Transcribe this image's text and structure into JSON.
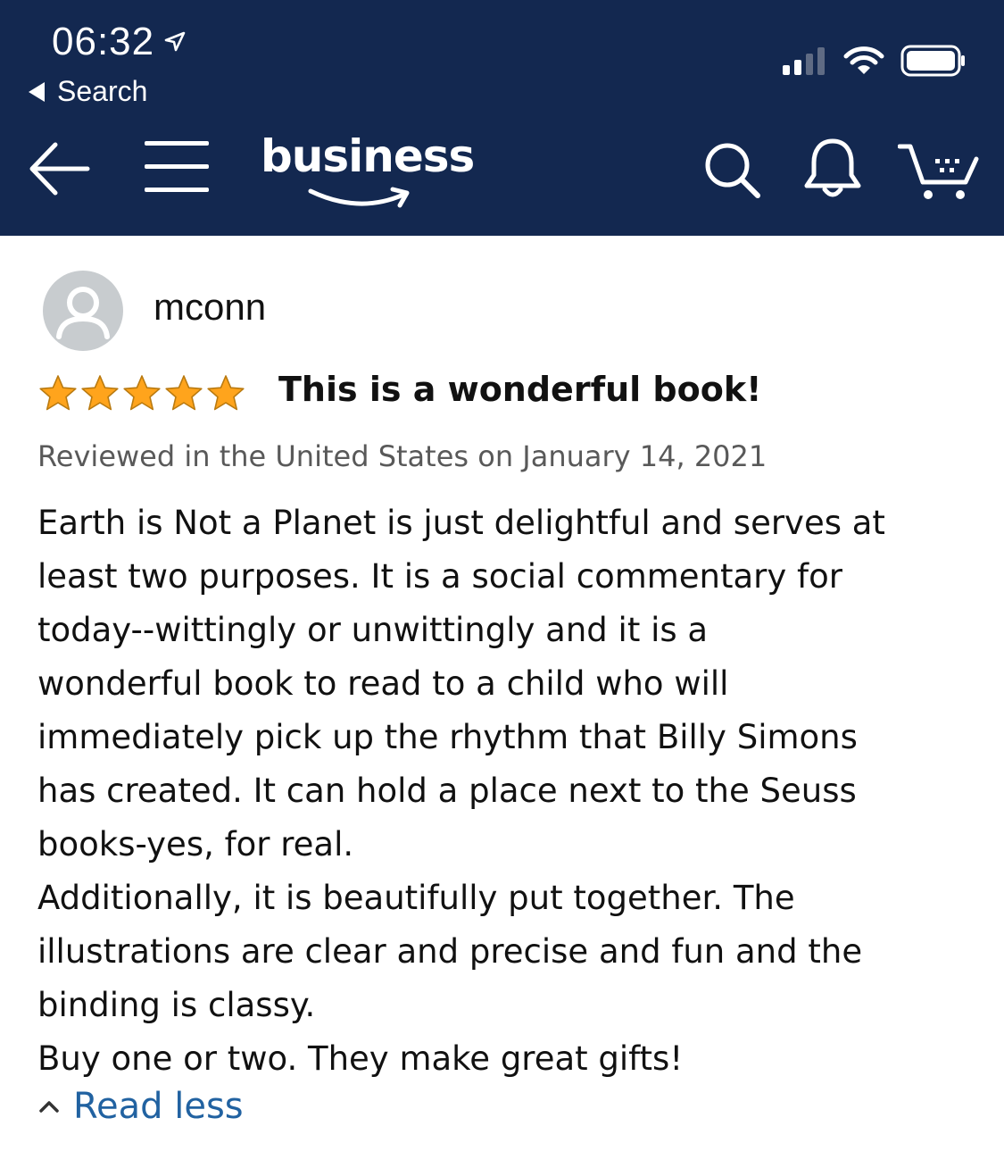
{
  "status_bar": {
    "time": "06:32",
    "back_app_label": "Search"
  },
  "nav": {
    "brand_text": "business"
  },
  "review": {
    "reviewer": "mconn",
    "rating": 5,
    "rating_max": 5,
    "title": "This is a wonderful book!",
    "meta": "Reviewed in the United States on January 14, 2021",
    "body_lines": [
      "Earth is Not a Planet is just delightful and serves at",
      "least two purposes. It is a social commentary for",
      "today--wittingly or unwittingly and it is a",
      "wonderful book to read to a child who will",
      "immediately pick up the rhythm that Billy Simons",
      "has created. It can hold a place next to the Seuss",
      "books-yes, for real.",
      "Additionally, it is beautifully put together. The",
      "illustrations are clear and precise and fun and the",
      "binding is classy.",
      "Buy one or two. They make great gifts!"
    ],
    "read_less_label": "Read less"
  },
  "colors": {
    "header_bg": "#132850",
    "star_fill": "#ffa41c",
    "link": "#2162a1",
    "meta_text": "#595959",
    "avatar_bg": "#c8cccf"
  },
  "icons": {
    "location": "location-arrow-icon",
    "signal": "cellular-signal-icon",
    "wifi": "wifi-icon",
    "battery": "battery-icon",
    "back": "back-arrow-icon",
    "menu": "hamburger-menu-icon",
    "search": "search-icon",
    "notifications": "bell-icon",
    "cart": "cart-icon",
    "avatar": "default-avatar-icon",
    "star": "star-icon",
    "collapse": "chevron-up-icon"
  }
}
